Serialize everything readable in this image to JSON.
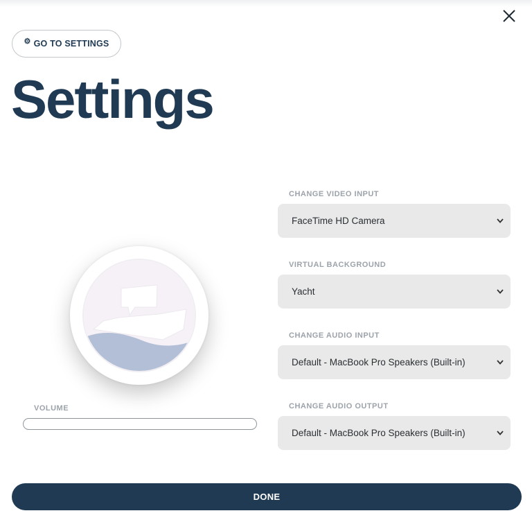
{
  "header": {
    "close_icon": "close-icon",
    "goto_settings": {
      "icon": "gear-icon",
      "label": "GO TO SETTINGS"
    },
    "title": "Settings"
  },
  "preview": {
    "avatar_icon": "yacht-background-icon",
    "volume_label": "VOLUME",
    "volume_level": 0
  },
  "fields": [
    {
      "label": "CHANGE VIDEO INPUT",
      "value": "FaceTime HD Camera"
    },
    {
      "label": "VIRTUAL BACKGROUND",
      "value": "Yacht"
    },
    {
      "label": "CHANGE AUDIO INPUT",
      "value": "Default - MacBook Pro Speakers (Built-in)"
    },
    {
      "label": "CHANGE AUDIO OUTPUT",
      "value": "Default - MacBook Pro Speakers (Built-in)"
    }
  ],
  "footer": {
    "done_label": "DONE"
  },
  "colors": {
    "primary": "#1f3a52",
    "select_bg": "#e9e9e9",
    "label_gray": "#9ca3aa",
    "wave": "#b3bfd6"
  }
}
